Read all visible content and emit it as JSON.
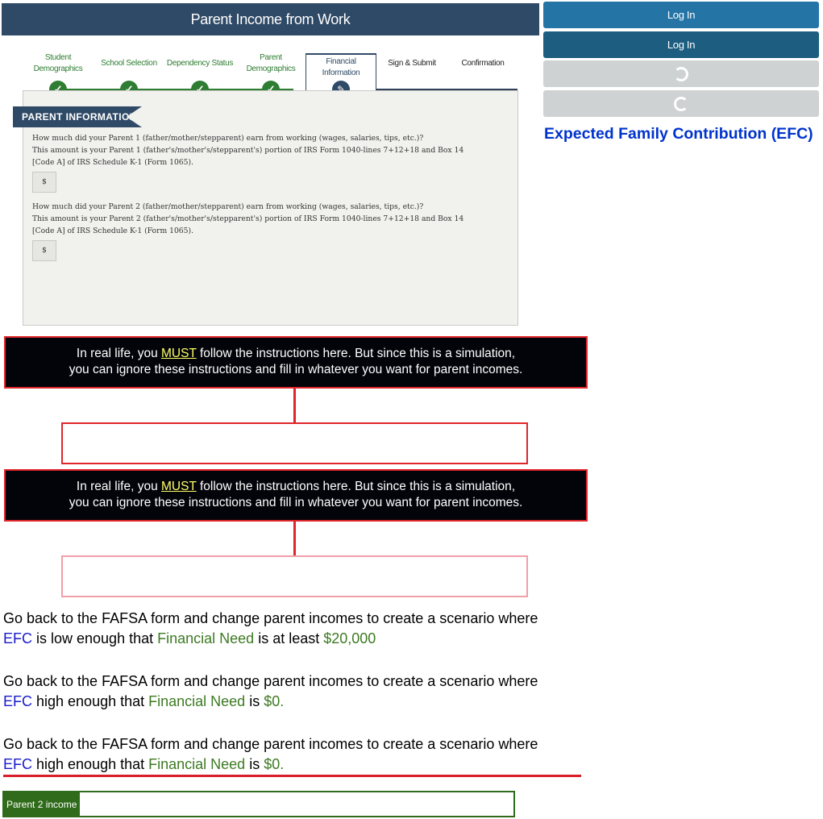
{
  "fafsa": {
    "header_title": "Parent Income from Work",
    "steps": [
      {
        "line1": "Student",
        "line2": "Demographics",
        "state": "complete"
      },
      {
        "line1": "School Selection",
        "line2": "",
        "state": "complete"
      },
      {
        "line1": "Dependency Status",
        "line2": "",
        "state": "complete"
      },
      {
        "line1": "Parent",
        "line2": "Demographics",
        "state": "complete"
      },
      {
        "line1": "Financial",
        "line2": "Information",
        "state": "active"
      },
      {
        "line1": "Sign & Submit",
        "line2": "",
        "state": "upcoming"
      },
      {
        "line1": "Confirmation",
        "line2": "",
        "state": "upcoming"
      }
    ],
    "section_title": "PARENT INFORMATION",
    "questions": [
      {
        "text_line1": "How much did your Parent 1 (father/mother/stepparent) earn from working (wages, salaries, tips, etc.)?",
        "text_line2": "This amount is your Parent 1 (father's/mother's/stepparent's) portion of IRS Form 1040-lines 7+12+18 and Box 14",
        "text_line3": "[Code A] of IRS Schedule K-1 (Form 1065).",
        "currency": "$"
      },
      {
        "text_line1": "How much did your Parent 2 (father/mother/stepparent) earn from working (wages, salaries, tips, etc.)?",
        "text_line2": "This amount is your Parent 2 (father's/mother's/stepparent's) portion of IRS Form 1040-lines 7+12+18 and Box 14",
        "text_line3": "[Code A] of IRS Schedule K-1 (Form 1065).",
        "currency": "$"
      }
    ]
  },
  "sidebar": {
    "login_1": "Log In",
    "login_2": "Log In",
    "efc_title": "Expected Family Contribution (EFC)"
  },
  "notice": {
    "part1": "In real life, you ",
    "must": "MUST",
    "part2": " follow the instructions here.  But since this is a simulation,",
    "line2": "you can ignore these instructions and fill in whatever you want for parent incomes."
  },
  "instructions": [
    {
      "lead": "Go back to the FAFSA form and change parent incomes to create a scenario where",
      "efc": "EFC",
      "mid": " is low enough that ",
      "need": "Financial Need",
      "tail": " is at least ",
      "amount": "$20,000"
    },
    {
      "lead": "Go back to the FAFSA form and change parent incomes to create a scenario where",
      "efc": "EFC",
      "mid": " high enough that ",
      "need": "Financial Need",
      "tail": " is ",
      "amount": "$0."
    },
    {
      "lead": "Go back to the FAFSA form and change parent incomes to create a scenario where",
      "efc": "EFC",
      "mid": " high enough that ",
      "need": "Financial Need",
      "tail": " is ",
      "amount": "$0."
    }
  ],
  "parent2_input": {
    "label": "Parent 2 income",
    "value": ""
  },
  "colors": {
    "header": "#2f4a66",
    "check_green": "#2e7d32",
    "notice_border": "#e0262b",
    "efc_blue": "#0033cc",
    "need_green": "#3d7a22"
  }
}
